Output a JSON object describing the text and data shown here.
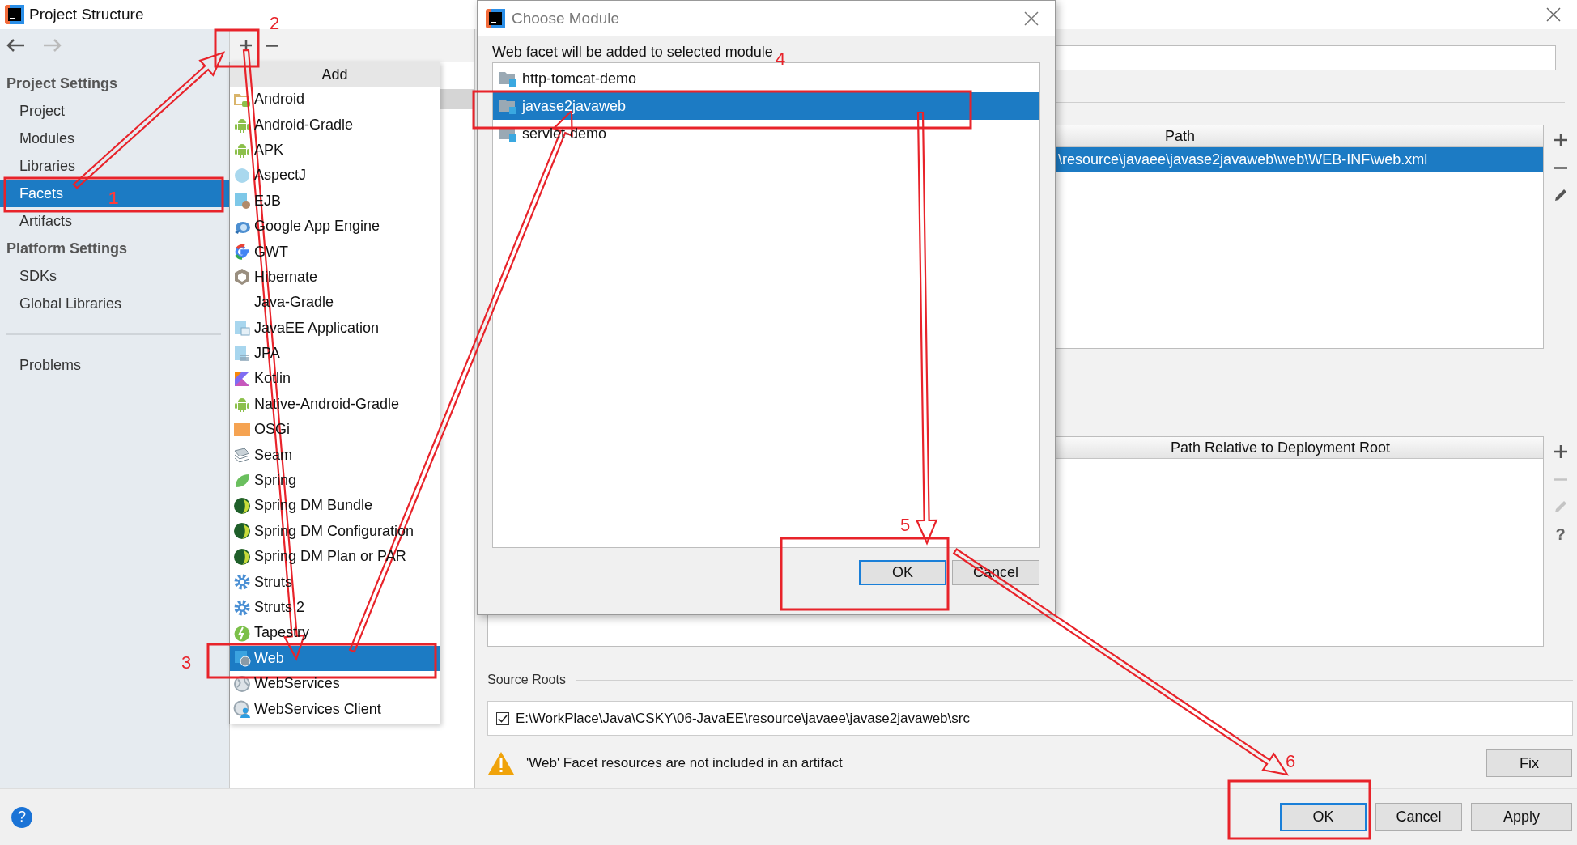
{
  "window": {
    "title": "Project Structure"
  },
  "sidebar": {
    "sections": [
      {
        "title": "Project Settings",
        "items": [
          {
            "label": "Project",
            "selected": false
          },
          {
            "label": "Modules",
            "selected": false
          },
          {
            "label": "Libraries",
            "selected": false
          },
          {
            "label": "Facets",
            "selected": true
          },
          {
            "label": "Artifacts",
            "selected": false
          }
        ]
      },
      {
        "title": "Platform Settings",
        "items": [
          {
            "label": "SDKs",
            "selected": false
          },
          {
            "label": "Global Libraries",
            "selected": false
          }
        ]
      }
    ],
    "footer_items": [
      {
        "label": "Problems",
        "selected": false
      }
    ]
  },
  "add_popup": {
    "title": "Add",
    "items": [
      {
        "label": "Android",
        "kind": "android-folder",
        "selected": false
      },
      {
        "label": "Android-Gradle",
        "kind": "android",
        "selected": false
      },
      {
        "label": "APK",
        "kind": "android",
        "selected": false
      },
      {
        "label": "AspectJ",
        "kind": "disc",
        "selected": false
      },
      {
        "label": "EJB",
        "kind": "ejb",
        "selected": false
      },
      {
        "label": "Google App Engine",
        "kind": "engine",
        "selected": false
      },
      {
        "label": "GWT",
        "kind": "google",
        "selected": false
      },
      {
        "label": "Hibernate",
        "kind": "hexagon",
        "selected": false
      },
      {
        "label": "Java-Gradle",
        "kind": "none",
        "selected": false
      },
      {
        "label": "JavaEE Application",
        "kind": "page",
        "selected": false
      },
      {
        "label": "JPA",
        "kind": "page-lines",
        "selected": false
      },
      {
        "label": "Kotlin",
        "kind": "kotlin",
        "selected": false
      },
      {
        "label": "Native-Android-Gradle",
        "kind": "android",
        "selected": false
      },
      {
        "label": "OSGi",
        "kind": "osgi",
        "selected": false
      },
      {
        "label": "Seam",
        "kind": "stack",
        "selected": false
      },
      {
        "label": "Spring",
        "kind": "leaf",
        "selected": false
      },
      {
        "label": "Spring DM Bundle",
        "kind": "sphere",
        "selected": false
      },
      {
        "label": "Spring DM Configuration",
        "kind": "sphere",
        "selected": false
      },
      {
        "label": "Spring DM Plan or PAR",
        "kind": "sphere",
        "selected": false
      },
      {
        "label": "Struts",
        "kind": "gear",
        "selected": false
      },
      {
        "label": "Struts 2",
        "kind": "gear",
        "selected": false
      },
      {
        "label": "Tapestry",
        "kind": "tapestry",
        "selected": false
      },
      {
        "label": "Web",
        "kind": "web",
        "selected": true
      },
      {
        "label": "WebServices",
        "kind": "globe",
        "selected": false
      },
      {
        "label": "WebServices Client",
        "kind": "globe-user",
        "selected": false
      }
    ]
  },
  "facet_editor": {
    "descriptors_table": {
      "columns": [
        "Path"
      ],
      "rows": [
        {
          "path": "\\resource\\javaee\\javase2javaweb\\web\\WEB-INF\\web.xml",
          "selected": true
        }
      ]
    },
    "web_resources_table": {
      "columns": [
        "Path Relative to Deployment Root"
      ]
    },
    "table_help_button": "?",
    "source_roots": {
      "title": "Source Roots",
      "items": [
        {
          "path": "E:\\WorkPlace\\Java\\CSKY\\06-JavaEE\\resource\\javaee\\javase2javaweb\\src",
          "checked": true
        }
      ]
    },
    "warning": {
      "text": "'Web' Facet resources are not included in an artifact",
      "fix_button": "Fix"
    }
  },
  "dialog": {
    "title": "Choose Module",
    "prompt": "Web facet will be added to selected module",
    "modules": [
      {
        "name": "http-tomcat-demo",
        "selected": false
      },
      {
        "name": "javase2javaweb",
        "selected": true
      },
      {
        "name": "servlet-demo",
        "selected": false
      }
    ],
    "buttons": [
      {
        "label": "OK",
        "default": true
      },
      {
        "label": "Cancel",
        "default": false
      }
    ]
  },
  "help_button": "?",
  "buttons": [
    {
      "label": "OK",
      "default": true
    },
    {
      "label": "Cancel",
      "default": false
    },
    {
      "label": "Apply",
      "default": false
    }
  ],
  "annotations": [
    {
      "number": "1"
    },
    {
      "number": "2"
    },
    {
      "number": "3"
    },
    {
      "number": "4"
    },
    {
      "number": "5"
    },
    {
      "number": "6"
    }
  ]
}
